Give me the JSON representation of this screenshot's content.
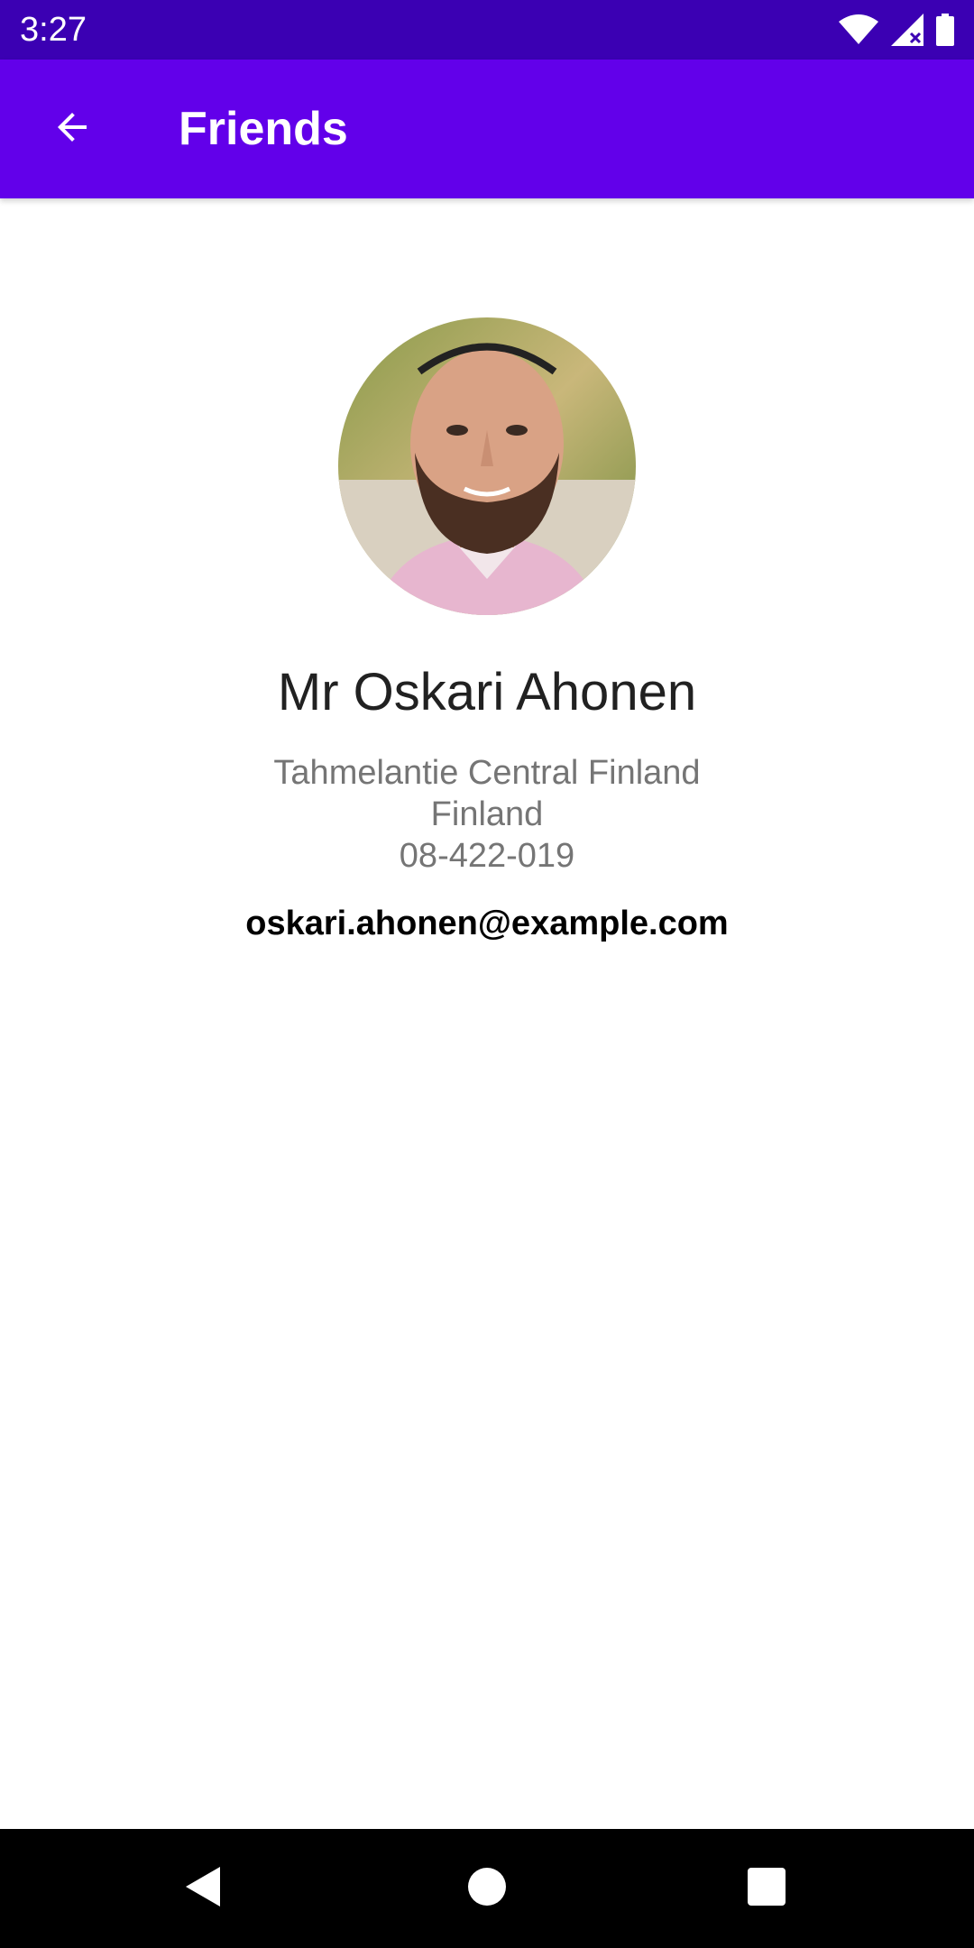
{
  "status_bar": {
    "time": "3:27",
    "icons": [
      "wifi-icon",
      "signal-icon",
      "battery-icon"
    ]
  },
  "app_bar": {
    "title": "Friends",
    "back_icon": "arrow-back-icon",
    "color": "#6200ea"
  },
  "profile": {
    "name": "Mr Oskari Ahonen",
    "address_line1": "Tahmelantie Central Finland",
    "address_line2": "Finland",
    "phone": "08-422-019",
    "email": "oskari.ahonen@example.com"
  },
  "nav_bar": {
    "icons": [
      "back-triangle-icon",
      "home-circle-icon",
      "recents-square-icon"
    ]
  },
  "colors": {
    "status_bar": "#3b00b3",
    "app_bar": "#6200ea",
    "secondary_text": "#757575"
  }
}
